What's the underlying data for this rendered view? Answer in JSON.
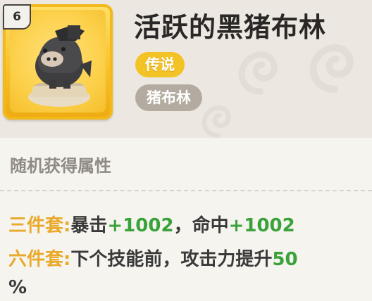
{
  "item": {
    "level": "6",
    "name": "活跃的黑猪布林",
    "rarity": "传说",
    "type": "猪布林"
  },
  "attributes": {
    "section_title": "随机获得属性",
    "set3": {
      "label": "三件套:",
      "text1": "暴击",
      "value1": "+1002",
      "sep": "，命中",
      "value2": "+1002"
    },
    "set6": {
      "label": "六件套:",
      "text": "下个技能前，攻击力提升",
      "value": "50",
      "tail": "%"
    }
  },
  "colors": {
    "label": "#e9a92a",
    "value": "#3aa23a",
    "rarity": "#f3c325",
    "frame": "#f8c22c"
  },
  "icons": {
    "item_icon": "black-pig-goblin-figure",
    "background": "swirl-decoration"
  }
}
